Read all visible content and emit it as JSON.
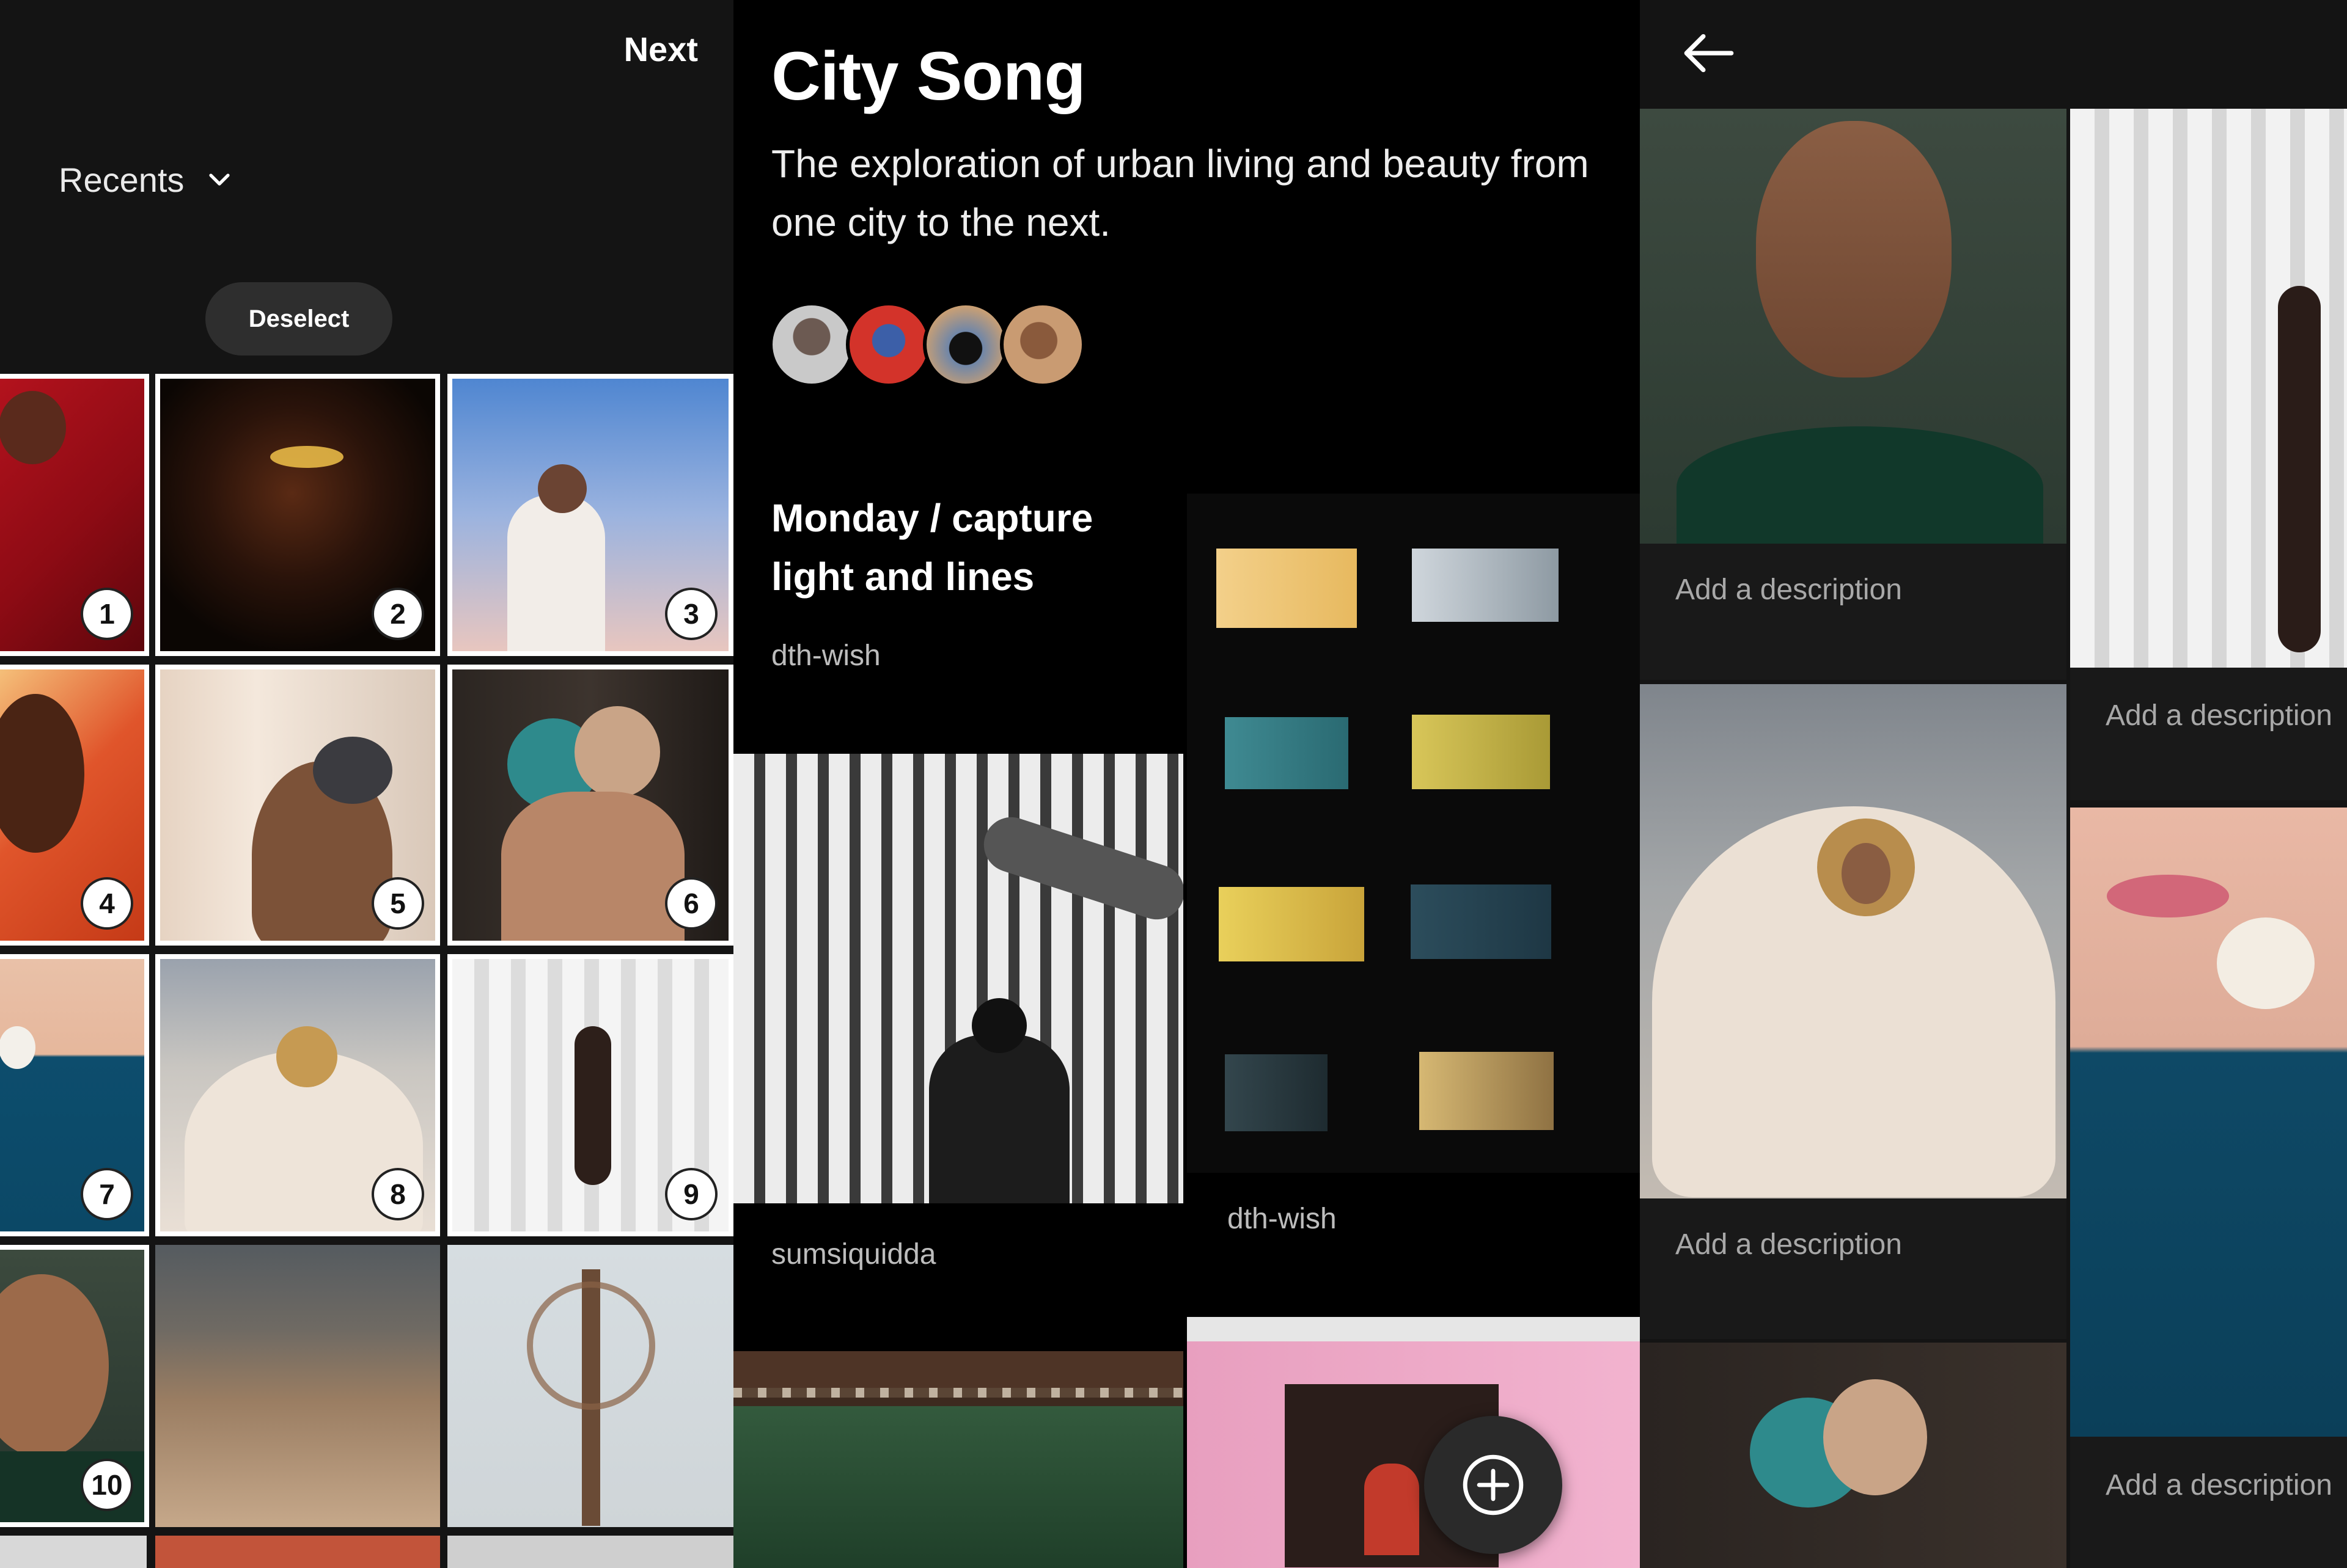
{
  "picker": {
    "next_label": "Next",
    "album_label": "Recents",
    "deselect_label": "Deselect",
    "selected_numbers": [
      "1",
      "2",
      "3",
      "4",
      "5",
      "6",
      "7",
      "8",
      "9",
      "10"
    ]
  },
  "story": {
    "title": "City Song",
    "description": "The exploration of urban living and beauty from one city to the next.",
    "section_title": "Monday / capture light and lines",
    "credits": [
      "dth-wish",
      "sumsiquidda",
      "dth-wish"
    ]
  },
  "editor": {
    "add_description_placeholder": "Add a description"
  },
  "colors": {
    "background": "#000000",
    "panel": "#141414",
    "pill": "#2e2e2e",
    "muted_text": "#a8a8a8"
  },
  "icons": [
    "chevron-down-icon",
    "back-arrow-icon",
    "add-circle-icon"
  ]
}
